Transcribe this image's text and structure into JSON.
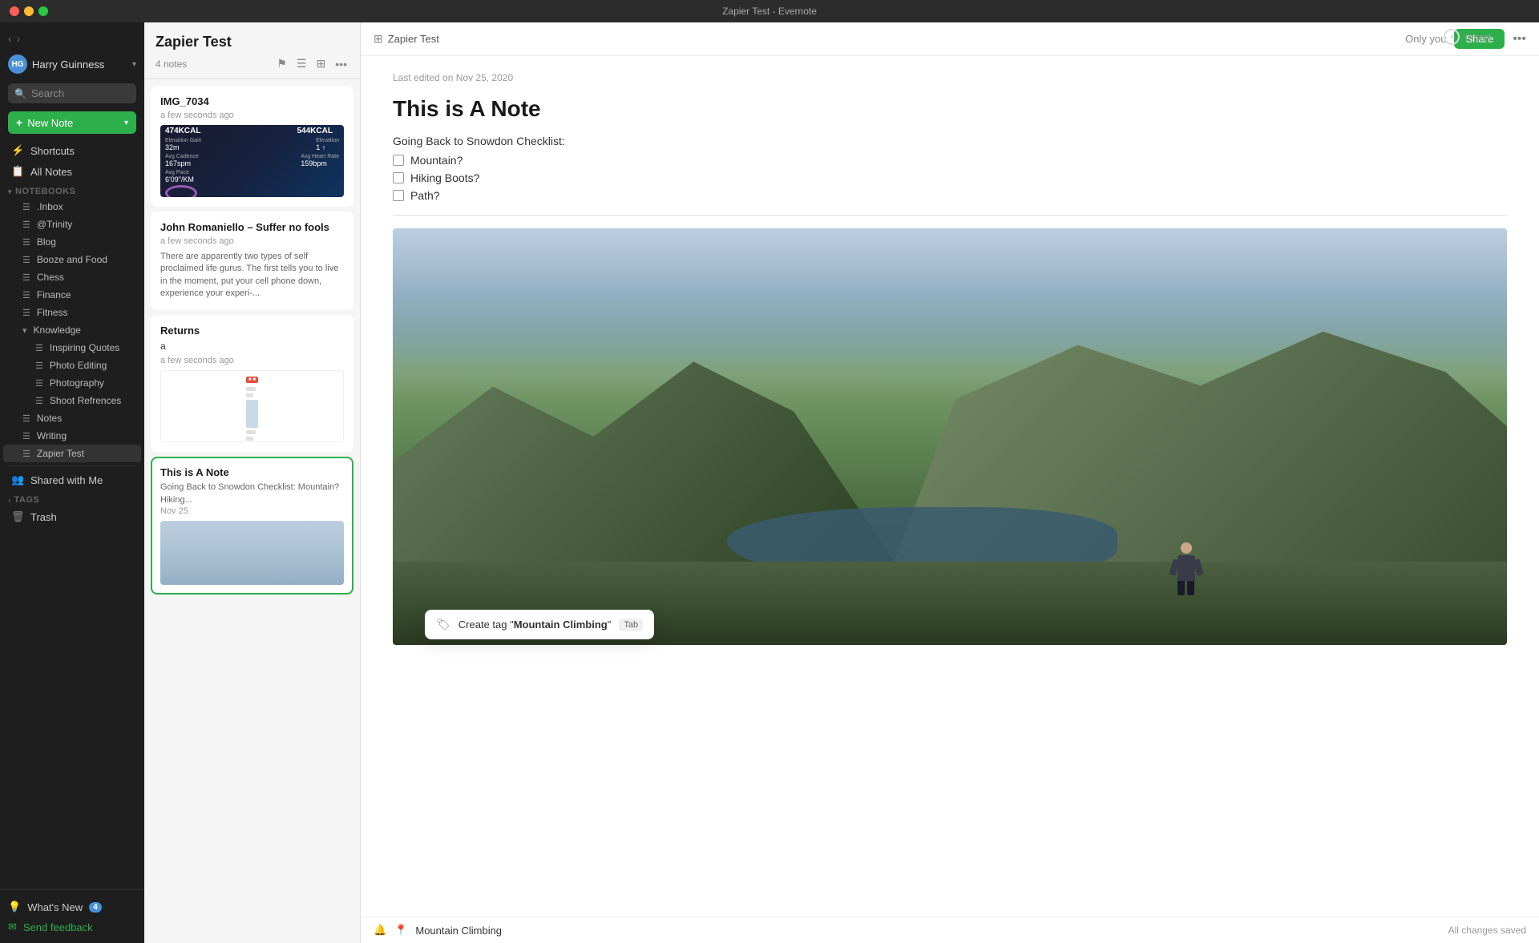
{
  "titlebar": {
    "title": "Zapier Test - Evernote"
  },
  "sidebar": {
    "user": {
      "name": "Harry Guinness",
      "initials": "HG"
    },
    "search_placeholder": "Search",
    "new_note_label": "+ New Note",
    "nav_items": [
      {
        "id": "shortcuts",
        "icon": "⚡",
        "label": "Shortcuts"
      },
      {
        "id": "all-notes",
        "icon": "📋",
        "label": "All Notes"
      }
    ],
    "notebooks_section": "Notebooks",
    "notebooks": [
      {
        "id": "inbox",
        "label": ".Inbox",
        "indent": 1
      },
      {
        "id": "trinity",
        "label": "@Trinity",
        "indent": 1
      },
      {
        "id": "blog",
        "label": "Blog",
        "indent": 1
      },
      {
        "id": "booze-food",
        "label": "Booze and Food",
        "indent": 1
      },
      {
        "id": "chess",
        "label": "Chess",
        "indent": 1
      },
      {
        "id": "finance",
        "label": "Finance",
        "indent": 1
      },
      {
        "id": "fitness",
        "label": "Fitness",
        "indent": 1
      },
      {
        "id": "knowledge",
        "label": "Knowledge",
        "indent": 1,
        "expanded": true
      },
      {
        "id": "inspiring-quotes",
        "label": "Inspiring Quotes",
        "indent": 2
      },
      {
        "id": "photo-editing",
        "label": "Photo Editing",
        "indent": 2
      },
      {
        "id": "photography",
        "label": "Photography",
        "indent": 2
      },
      {
        "id": "shoot-references",
        "label": "Shoot Refrences",
        "indent": 2
      },
      {
        "id": "notes",
        "label": "Notes",
        "indent": 1
      },
      {
        "id": "writing",
        "label": "Writing",
        "indent": 1
      },
      {
        "id": "zapier-test",
        "label": "Zapier Test",
        "indent": 1,
        "active": true
      }
    ],
    "shared_with_me": "Shared with Me",
    "tags_section": "Tags",
    "trash": "Trash",
    "whats_new": "What's New",
    "whats_new_badge": "4",
    "send_feedback": "Send feedback"
  },
  "note_list": {
    "title": "Zapier Test",
    "count": "4 notes",
    "notes": [
      {
        "id": "img-7034",
        "title": "IMG_7034",
        "time": "a few seconds ago",
        "type": "fitness"
      },
      {
        "id": "john-romaniello",
        "title": "John Romaniello – Suffer no fools",
        "time": "a few seconds ago",
        "preview": "There are apparently two types of self proclaimed life gurus. The first tells you to live in the moment, put your cell phone down, experience your experi-..."
      },
      {
        "id": "returns",
        "title": "Returns",
        "preview_short": "a",
        "time": "a few seconds ago",
        "type": "doc"
      },
      {
        "id": "this-is-a-note",
        "title": "This is A Note",
        "preview": "Going Back to Snowdon Checklist: Mountain? Hiking...",
        "time": "Nov 25",
        "type": "mountain",
        "selected": true
      }
    ]
  },
  "editor": {
    "breadcrumb": "Zapier Test",
    "last_edited": "Last edited on Nov 25, 2020",
    "title": "This is A Note",
    "checklist_label": "Going Back to Snowdon Checklist:",
    "checklist_items": [
      "Mountain?",
      "Hiking Boots?",
      "Path?"
    ],
    "only_you": "Only you",
    "share_label": "Share",
    "insert_label": "Insert",
    "status": "All changes saved",
    "tag_value": "Mountain Climbing",
    "tag_suggestion_text": "Create tag",
    "tag_suggestion_value": "Mountain Climbing",
    "tag_shortcut": "Tab"
  }
}
